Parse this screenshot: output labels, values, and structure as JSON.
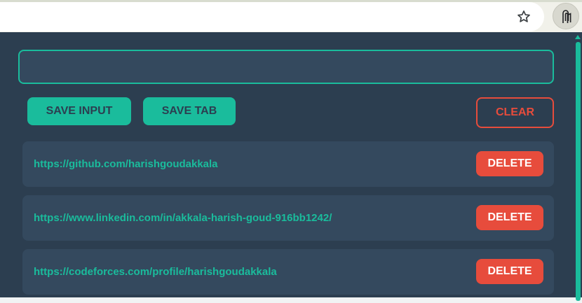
{
  "browser": {
    "star_icon": "star-outline-icon",
    "extension_icon": "extension-clip-icon"
  },
  "popup": {
    "input": {
      "value": "",
      "placeholder": ""
    },
    "buttons": {
      "save_input": "SAVE INPUT",
      "save_tab": "SAVE TAB",
      "clear": "CLEAR"
    },
    "links": [
      {
        "url": "https://github.com/harishgoudakkala",
        "delete_label": "DELETE"
      },
      {
        "url": "https://www.linkedin.com/in/akkala-harish-goud-916bb1242/",
        "delete_label": "DELETE"
      },
      {
        "url": "https://codeforces.com/profile/harishgoudakkala",
        "delete_label": "DELETE"
      }
    ]
  },
  "colors": {
    "accent": "#1abc9c",
    "danger": "#e74c3c",
    "background": "#2c3e50",
    "panel": "#34495e"
  }
}
